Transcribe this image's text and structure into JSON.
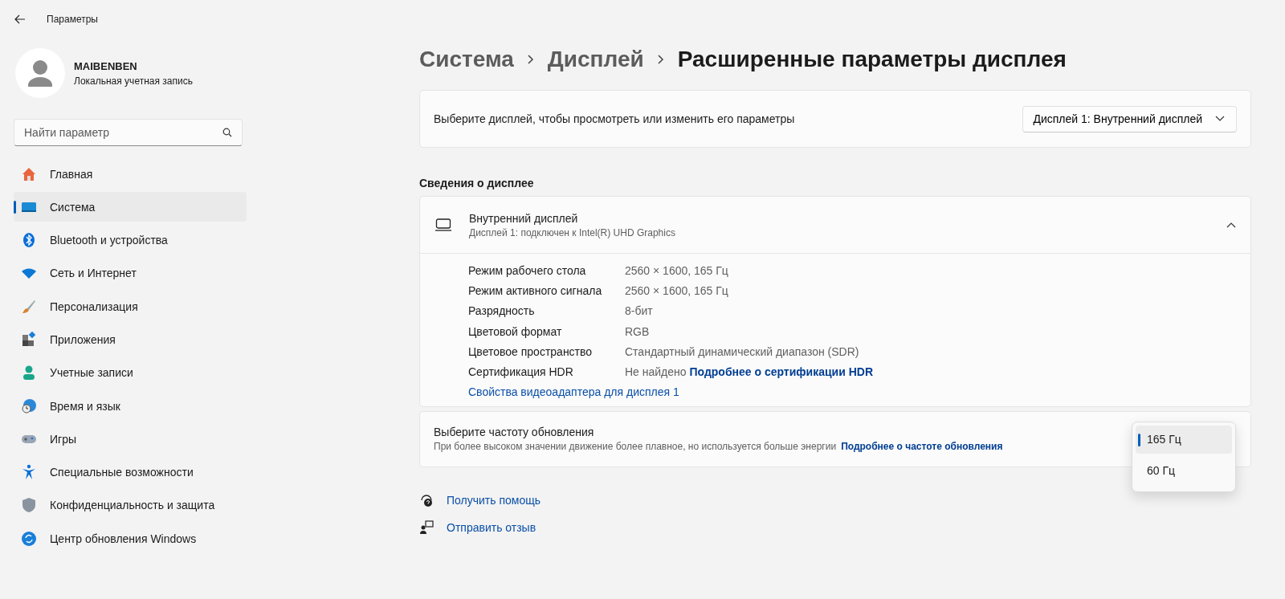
{
  "window": {
    "title": "Параметры"
  },
  "account": {
    "name": "MAIBENBEN",
    "type": "Локальная учетная запись"
  },
  "search": {
    "placeholder": "Найти параметр"
  },
  "nav": [
    {
      "label": "Главная",
      "selected": false
    },
    {
      "label": "Система",
      "selected": true
    },
    {
      "label": "Bluetooth и устройства",
      "selected": false
    },
    {
      "label": "Сеть и Интернет",
      "selected": false
    },
    {
      "label": "Персонализация",
      "selected": false
    },
    {
      "label": "Приложения",
      "selected": false
    },
    {
      "label": "Учетные записи",
      "selected": false
    },
    {
      "label": "Время и язык",
      "selected": false
    },
    {
      "label": "Игры",
      "selected": false
    },
    {
      "label": "Специальные возможности",
      "selected": false
    },
    {
      "label": "Конфиденциальность и защита",
      "selected": false
    },
    {
      "label": "Центр обновления Windows",
      "selected": false
    }
  ],
  "breadcrumb": [
    "Система",
    "Дисплей",
    "Расширенные параметры дисплея"
  ],
  "display_select": {
    "label": "Выберите дисплей, чтобы просмотреть или изменить его параметры",
    "value": "Дисплей 1: Внутренний дисплей"
  },
  "section_title": "Сведения о дисплее",
  "display_info": {
    "title": "Внутренний дисплей",
    "subtitle": "Дисплей 1: подключен к Intel(R) UHD Graphics",
    "expanded": true,
    "rows": [
      {
        "label": "Режим рабочего стола",
        "value": "2560 × 1600, 165 Гц"
      },
      {
        "label": "Режим активного сигнала",
        "value": "2560 × 1600, 165 Гц"
      },
      {
        "label": "Разрядность",
        "value": "8-бит"
      },
      {
        "label": "Цветовой формат",
        "value": "RGB"
      },
      {
        "label": "Цветовое пространство",
        "value": "Стандартный динамический диапазон (SDR)"
      },
      {
        "label": "Сертификация HDR",
        "value": "Не найдено",
        "link": "Подробнее о сертификации HDR"
      }
    ],
    "adapter_link": "Свойства видеоадаптера для дисплея 1"
  },
  "refresh": {
    "title": "Выберите частоту обновления",
    "description": "При более высоком значении движение более плавное, но используется больше энергии",
    "link": "Подробнее о частоте обновления",
    "options": [
      {
        "label": "165 Гц",
        "selected": true
      },
      {
        "label": "60 Гц",
        "selected": false
      }
    ]
  },
  "footer_links": [
    "Получить помощь",
    "Отправить отзыв"
  ]
}
